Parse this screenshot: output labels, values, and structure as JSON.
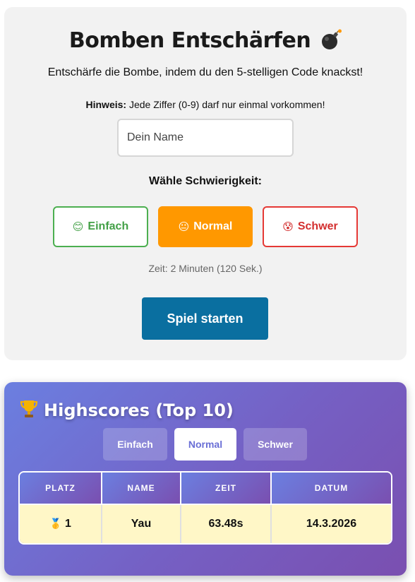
{
  "game": {
    "title": "Bomben Entschärfen",
    "title_icon": "bomb-icon",
    "subtitle": "Entschärfe die Bombe, indem du den 5-stelligen Code knackst!",
    "hint_label": "Hinweis:",
    "hint_text": " Jede Ziffer (0-9) darf nur einmal vorkommen!",
    "name_placeholder": "Dein Name",
    "difficulty_heading": "Wähle Schwierigkeit:",
    "difficulties": [
      {
        "emoji": "😊",
        "label": "Einfach",
        "color": "#43a047"
      },
      {
        "emoji": "😐",
        "label": "Normal",
        "color": "#ff9800",
        "selected": true
      },
      {
        "emoji": "😰",
        "label": "Schwer",
        "color": "#d32f2f"
      }
    ],
    "time_info": "Zeit: 2 Minuten (120 Sek.)",
    "start_label": "Spiel starten",
    "start_color": "#0a6fa0"
  },
  "highscores": {
    "title_icon": "trophy-icon",
    "title": "Highscores (Top 10)",
    "tabs": [
      {
        "label": "Einfach",
        "active": false
      },
      {
        "label": "Normal",
        "active": true
      },
      {
        "label": "Schwer",
        "active": false
      }
    ],
    "columns": [
      "PLATZ",
      "NAME",
      "ZEIT",
      "DATUM"
    ],
    "rows": [
      {
        "medal": "🥇",
        "rank": "1",
        "name": "Yau",
        "time": "63.48s",
        "date": "14.3.2026"
      }
    ]
  }
}
